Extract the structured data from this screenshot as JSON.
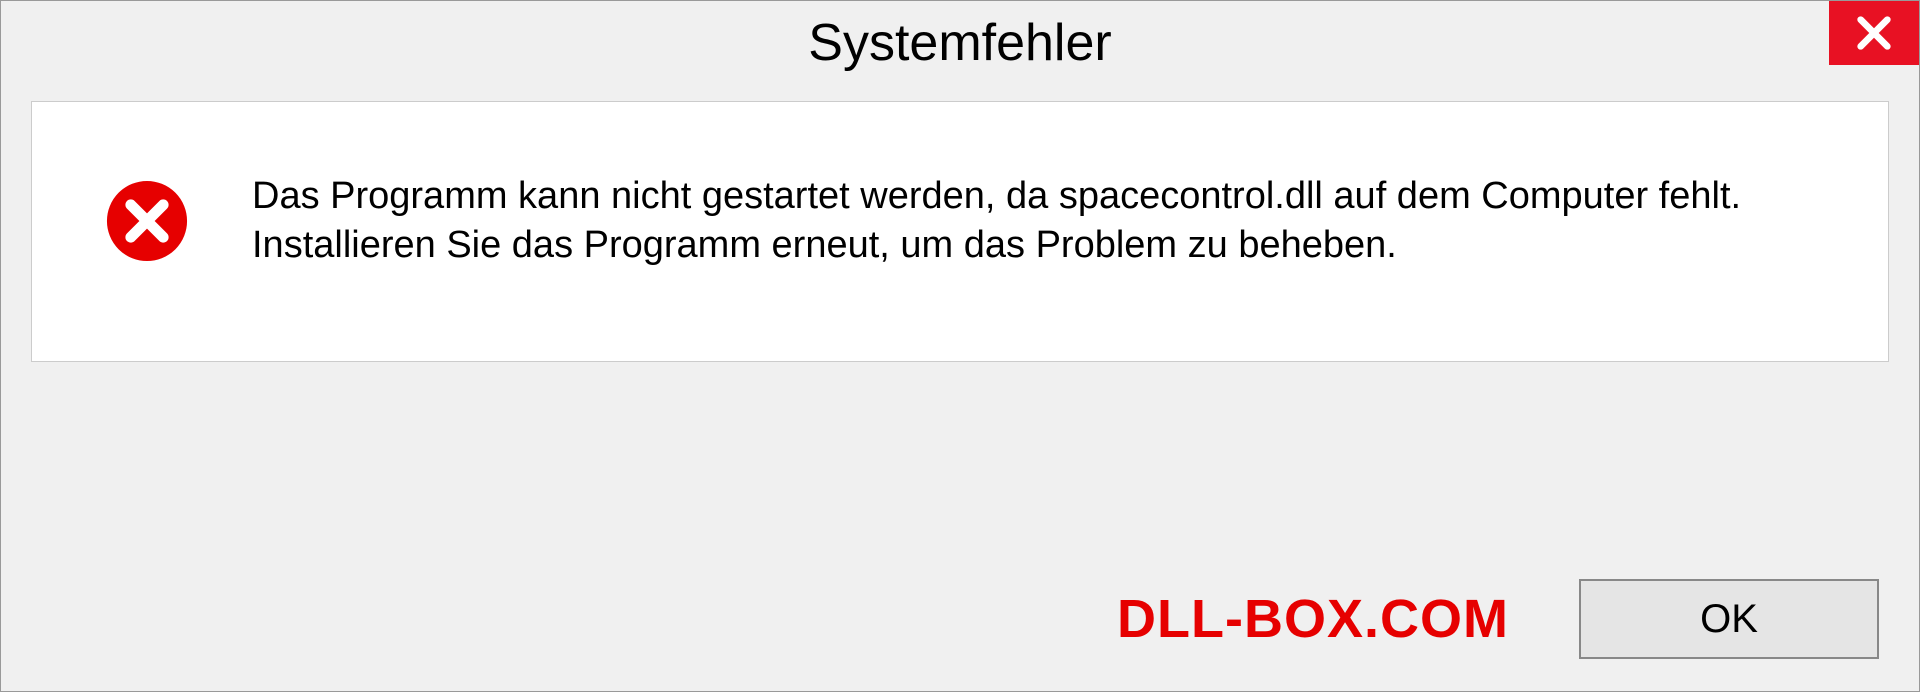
{
  "dialog": {
    "title": "Systemfehler",
    "message": "Das Programm kann nicht gestartet werden, da spacecontrol.dll auf dem Computer fehlt. Installieren Sie das Programm erneut, um das Problem zu beheben.",
    "ok_label": "OK"
  },
  "watermark": "DLL-BOX.COM",
  "colors": {
    "close_bg": "#e81123",
    "error_icon": "#e60000",
    "watermark": "#e60000"
  }
}
